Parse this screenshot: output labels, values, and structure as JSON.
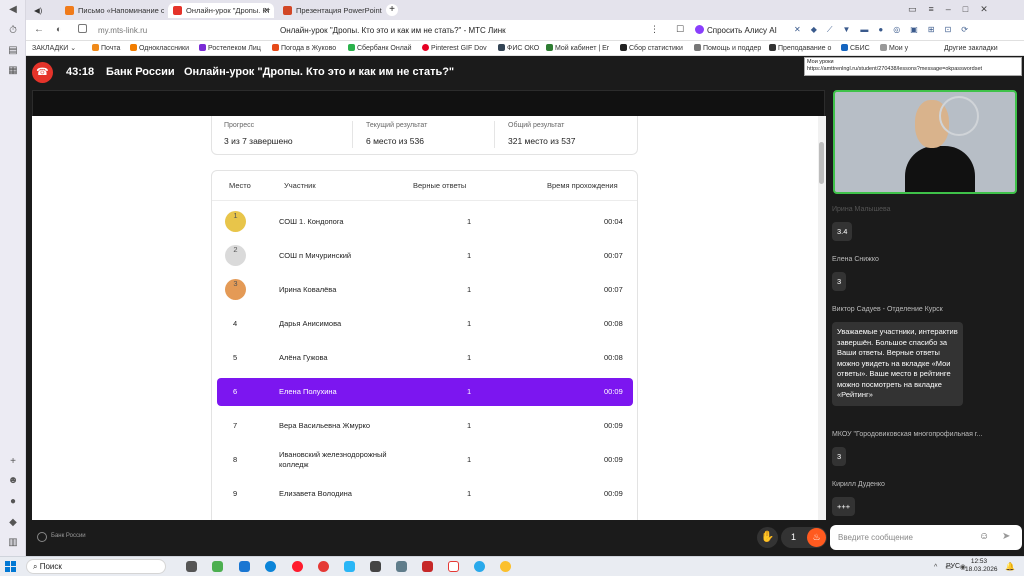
{
  "browser": {
    "tabs": [
      {
        "label": "Письмо «Напоминание о",
        "active": false
      },
      {
        "label": "Онлайн-урок \"Дропы. Кт",
        "active": true
      },
      {
        "label": "Презентация PowerPoint",
        "active": false
      }
    ],
    "url": "my.mts-link.ru",
    "page_title": "Онлайн-урок \"Дропы. Кто это и как им не стать?\" - МТС Линк",
    "alice_label": "Спросить Алису AI",
    "bookmarks": [
      "ЗАКЛАДКИ",
      "Почта",
      "Одноклассники",
      "Ростелеком Лиц",
      "Погода в Жуково",
      "Сбербанк Онлай",
      "Pinterest GIF Dov",
      "ФИС ОКО",
      "Мой кабинет | Er",
      "Сбор статистики",
      "Помощь и поддер",
      "Преподавание о",
      "СБИС",
      "Мои у"
    ],
    "other_bookmarks": "Другие закладки",
    "tooltip_title": "Мои уроки",
    "tooltip_url": "https://amttrenlngl.ru/student/270438/lessons?message=okpasswordset"
  },
  "meeting": {
    "timer": "43:18",
    "org": "Банк России",
    "title": "Онлайн-урок \"Дропы. Кто это и как им не стать?\""
  },
  "stats": {
    "progress_label": "Прогресс",
    "progress_value": "3 из 7 завершено",
    "current_label": "Текущий результат",
    "current_value": "6 место из 536",
    "total_label": "Общий результат",
    "total_value": "321 место из 537"
  },
  "table": {
    "headers": {
      "place": "Место",
      "participant": "Участник",
      "correct": "Верные ответы",
      "time": "Время прохождения"
    },
    "rows": [
      {
        "place": "1",
        "name": "СОШ 1. Кондопога",
        "correct": "1",
        "time": "00:04",
        "medal": "gold"
      },
      {
        "place": "2",
        "name": "СОШ п Мичуринский",
        "correct": "1",
        "time": "00:07",
        "medal": "silver"
      },
      {
        "place": "3",
        "name": "Ирина Ковалёва",
        "correct": "1",
        "time": "00:07",
        "medal": "bronze"
      },
      {
        "place": "4",
        "name": "Дарья Анисимова",
        "correct": "1",
        "time": "00:08",
        "medal": ""
      },
      {
        "place": "5",
        "name": "Алёна Гужова",
        "correct": "1",
        "time": "00:08",
        "medal": ""
      },
      {
        "place": "6",
        "name": "Елена Полухина",
        "correct": "1",
        "time": "00:09",
        "medal": "",
        "highlight": true
      },
      {
        "place": "7",
        "name": "Вера Васильевна Жмурко",
        "correct": "1",
        "time": "00:09",
        "medal": ""
      },
      {
        "place": "8",
        "name": "Ивановский железнодорожный колледж",
        "correct": "1",
        "time": "00:09",
        "medal": ""
      },
      {
        "place": "9",
        "name": "Елизавета Володина",
        "correct": "1",
        "time": "00:09",
        "medal": ""
      }
    ]
  },
  "chat": {
    "messages": [
      {
        "author": "Ирина Малышева",
        "text": "3.4"
      },
      {
        "author": "Елена Снижко",
        "text": "3"
      },
      {
        "author": "Виктор Садуев - Отделение Курск",
        "text": "Уважаемые участники, интерактив завершён. Большое спасибо за Ваши ответы. Верные ответы можно увидеть на вкладке «Мои ответы». Ваше место в рейтинге можно посмотреть на вкладке «Рейтинг»"
      },
      {
        "author": "МКОУ \"Городовиковская многопрофильная г...",
        "text": "3"
      },
      {
        "author": "Кирилл Дуденко",
        "text": "+++"
      }
    ],
    "input_placeholder": "Введите сообщение"
  },
  "bottom": {
    "logo_text": "Банк России",
    "reactions_count": "1"
  },
  "taskbar": {
    "search": "Поиск",
    "lang": "РУС",
    "time": "12:53",
    "date": "18.03.2026"
  },
  "colors": {
    "accent": "#7c16f0",
    "end_call": "#e5332a",
    "video_border": "#3fc24a",
    "reaction": "#ff5a1f"
  }
}
